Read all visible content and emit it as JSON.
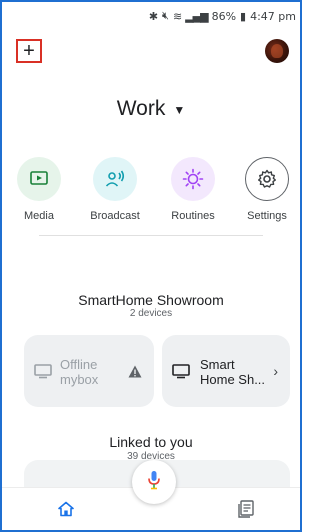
{
  "status_bar": {
    "icons": [
      "bluetooth-icon",
      "mute-icon",
      "wifi-icon",
      "signal-icon",
      "battery-icon"
    ],
    "battery": "86%",
    "time": "4:47 pm"
  },
  "header": {
    "add_label": "+",
    "home_name": "Work",
    "caret": "▼"
  },
  "shortcuts": [
    {
      "label": "Media",
      "icon": "media-icon",
      "color": "#e6f4ea"
    },
    {
      "label": "Broadcast",
      "icon": "broadcast-icon",
      "color": "#e0f5f7"
    },
    {
      "label": "Routines",
      "icon": "routines-icon",
      "color": "#f3e8fd"
    },
    {
      "label": "Settings",
      "icon": "gear-icon",
      "color": "#ffffff"
    }
  ],
  "room": {
    "title": "SmartHome Showroom",
    "count": "2 devices",
    "devices": [
      {
        "name_line1": "Offline",
        "name_line2": "mybox",
        "icon": "tv-icon",
        "status_icon": "warning-icon"
      },
      {
        "name_line1": "Smart",
        "name_line2": "Home Sh...",
        "icon": "display-icon",
        "status_icon": "chevron-right-icon"
      }
    ]
  },
  "linked": {
    "title": "Linked to you",
    "count": "39 devices"
  },
  "nav": {
    "home_icon": "home-icon",
    "feed_icon": "feed-icon",
    "mic_icon": "mic-icon",
    "accent": "#1a73e8"
  }
}
